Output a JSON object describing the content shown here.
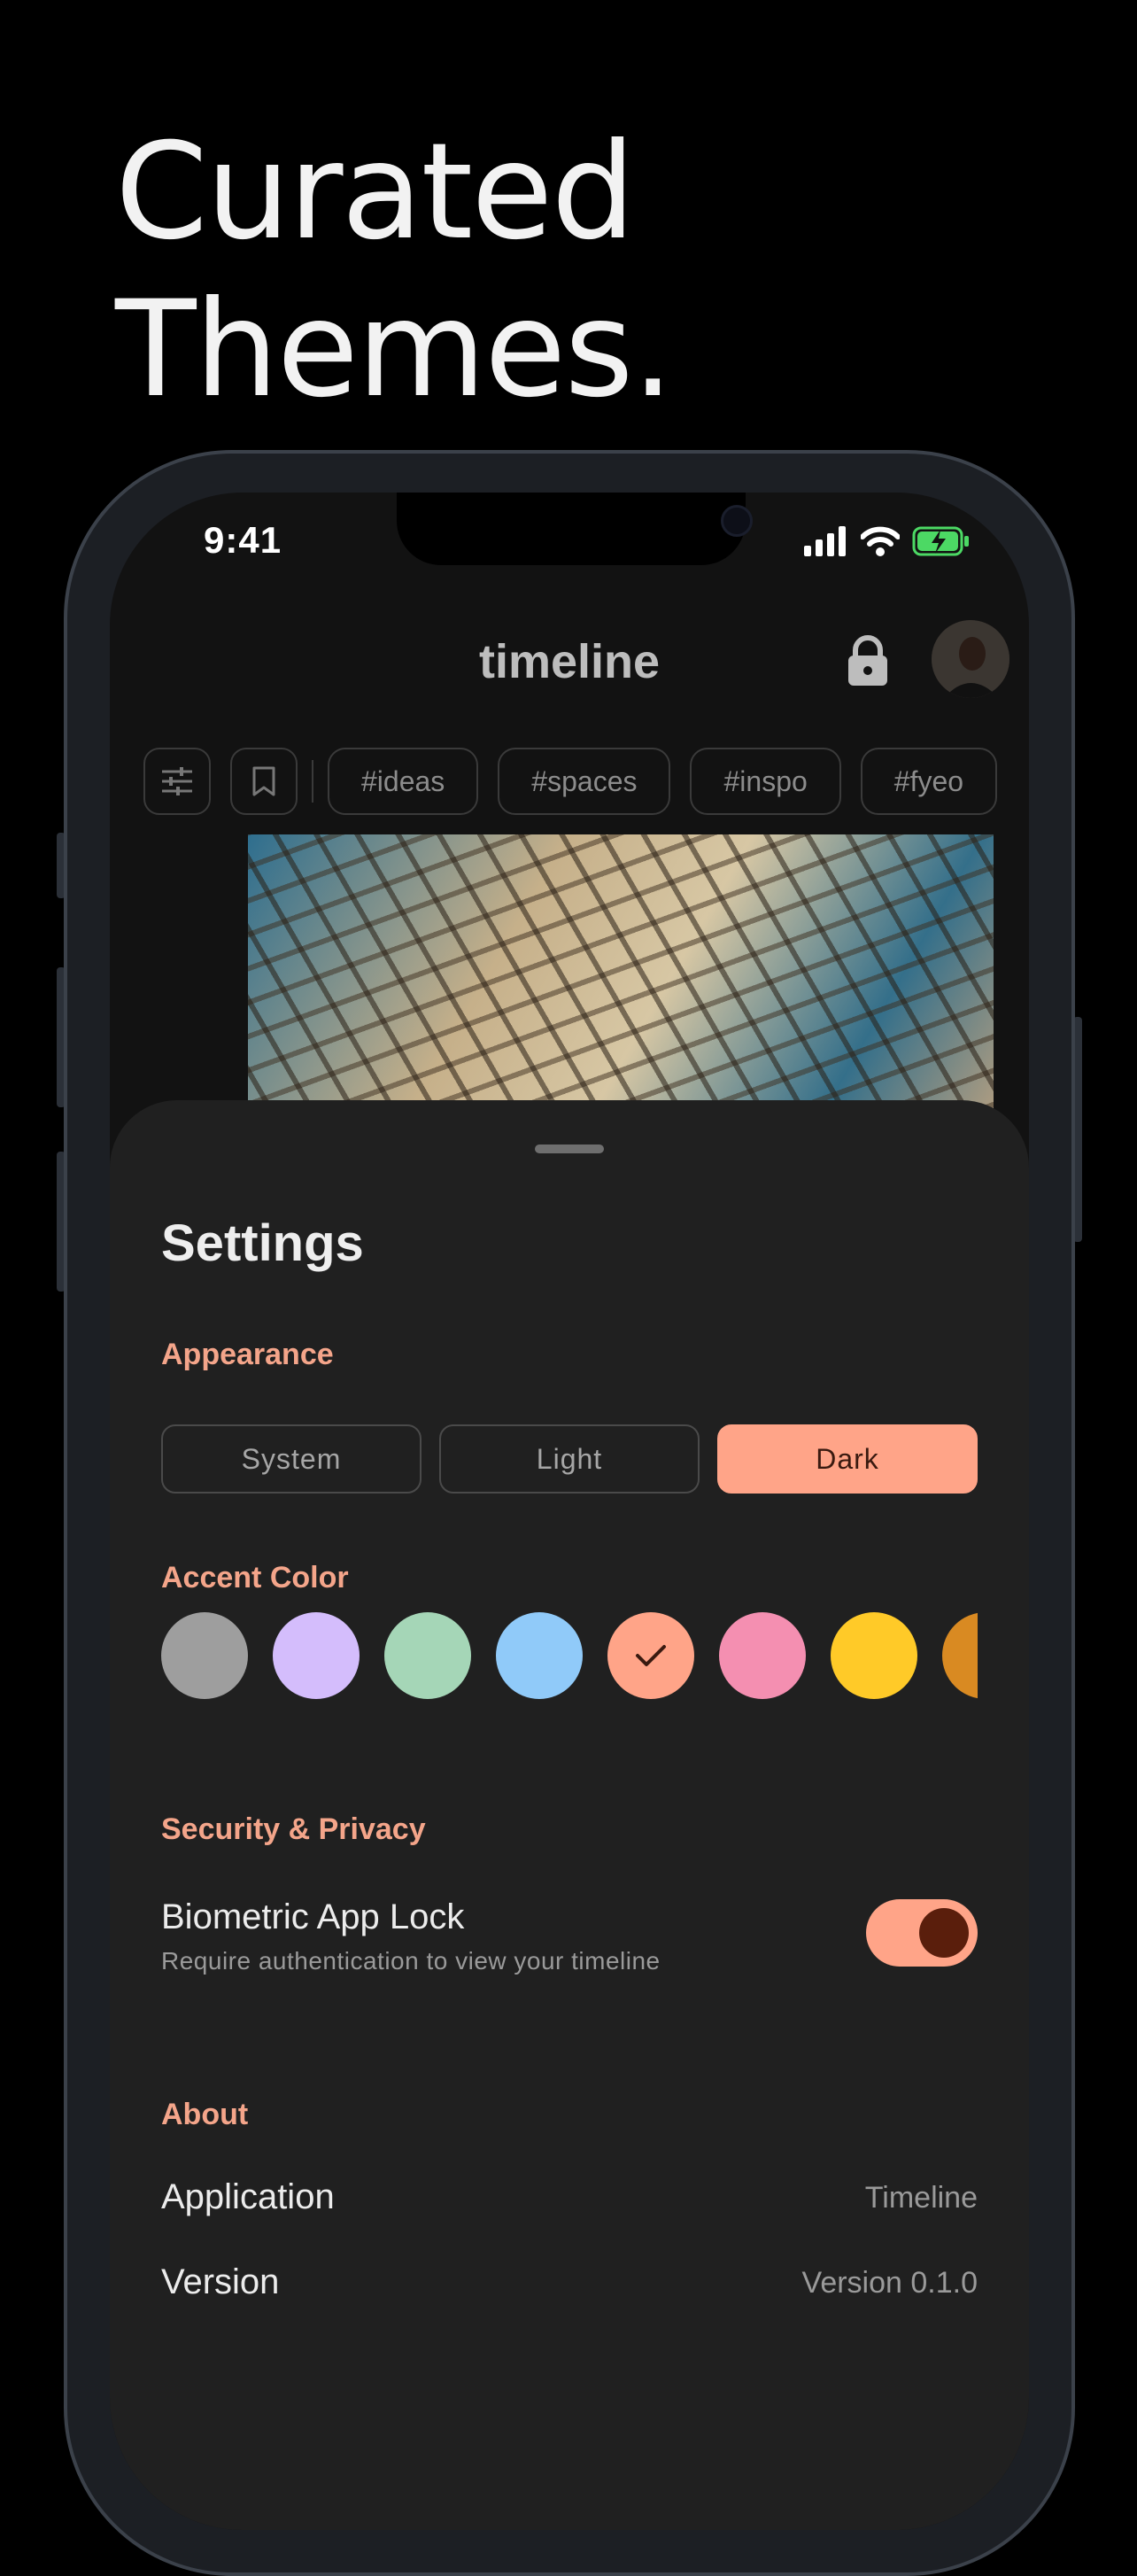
{
  "hero": {
    "line1": "Curated",
    "line2": "Themes."
  },
  "status_bar": {
    "time": "9:41"
  },
  "header": {
    "title": "timeline"
  },
  "chips": [
    "#ideas",
    "#spaces",
    "#inspo",
    "#fyeo"
  ],
  "settings": {
    "title": "Settings",
    "appearance": {
      "label": "Appearance",
      "options": [
        "System",
        "Light",
        "Dark"
      ],
      "selected": "Dark"
    },
    "accent": {
      "label": "Accent Color",
      "colors": [
        "#9e9e9e",
        "#d4bdfc",
        "#a5d6b7",
        "#90caf9",
        "#ffa488",
        "#f48fb1",
        "#ffca28",
        "#d98a22"
      ],
      "selected_index": 4
    },
    "security": {
      "label": "Security & Privacy",
      "biometric_title": "Biometric App Lock",
      "biometric_sub": "Require authentication to view your timeline",
      "biometric_on": true
    },
    "about": {
      "label": "About",
      "application_label": "Application",
      "application_value": "Timeline",
      "version_label": "Version",
      "version_value": "Version 0.1.0"
    }
  }
}
